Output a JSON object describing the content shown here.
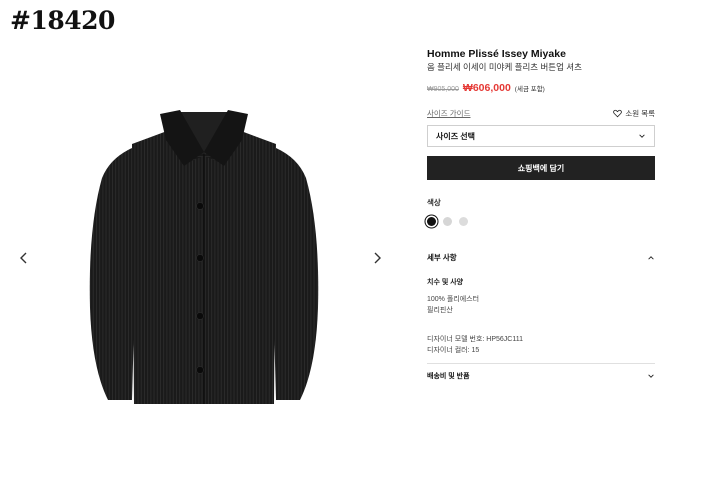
{
  "watermark": "#18420",
  "product": {
    "brand": "Homme Plissé Issey Miyake",
    "name": "옴 플리세 이세이 미야케 플리츠 버튼업 셔츠",
    "original_price": "₩905,000",
    "sale_price": "₩606,000",
    "tax_note": "(세금 포함)"
  },
  "actions": {
    "size_guide": "사이즈 가이드",
    "wishlist": "소원 목록",
    "size_select": "사이즈 선택",
    "add_to_cart": "쇼핑백에 담기"
  },
  "colors": {
    "label": "색상",
    "swatches": [
      "#111111",
      "#d6d6d6",
      "#dcdcdc"
    ]
  },
  "details": {
    "header": "세부 사항",
    "section_title": "치수 및 사양",
    "material_line1": "100% 폴리에스터",
    "material_line2": "필리핀산",
    "designer_model": "디자이너 모델 번호: HP56JC111",
    "designer_color": "디자이너 컬러: 15"
  },
  "shipping": {
    "header": "배송비 및 반품"
  },
  "icons": [
    "chevron-left-icon",
    "chevron-right-icon",
    "heart-icon",
    "chevron-down-icon",
    "chevron-up-icon"
  ]
}
